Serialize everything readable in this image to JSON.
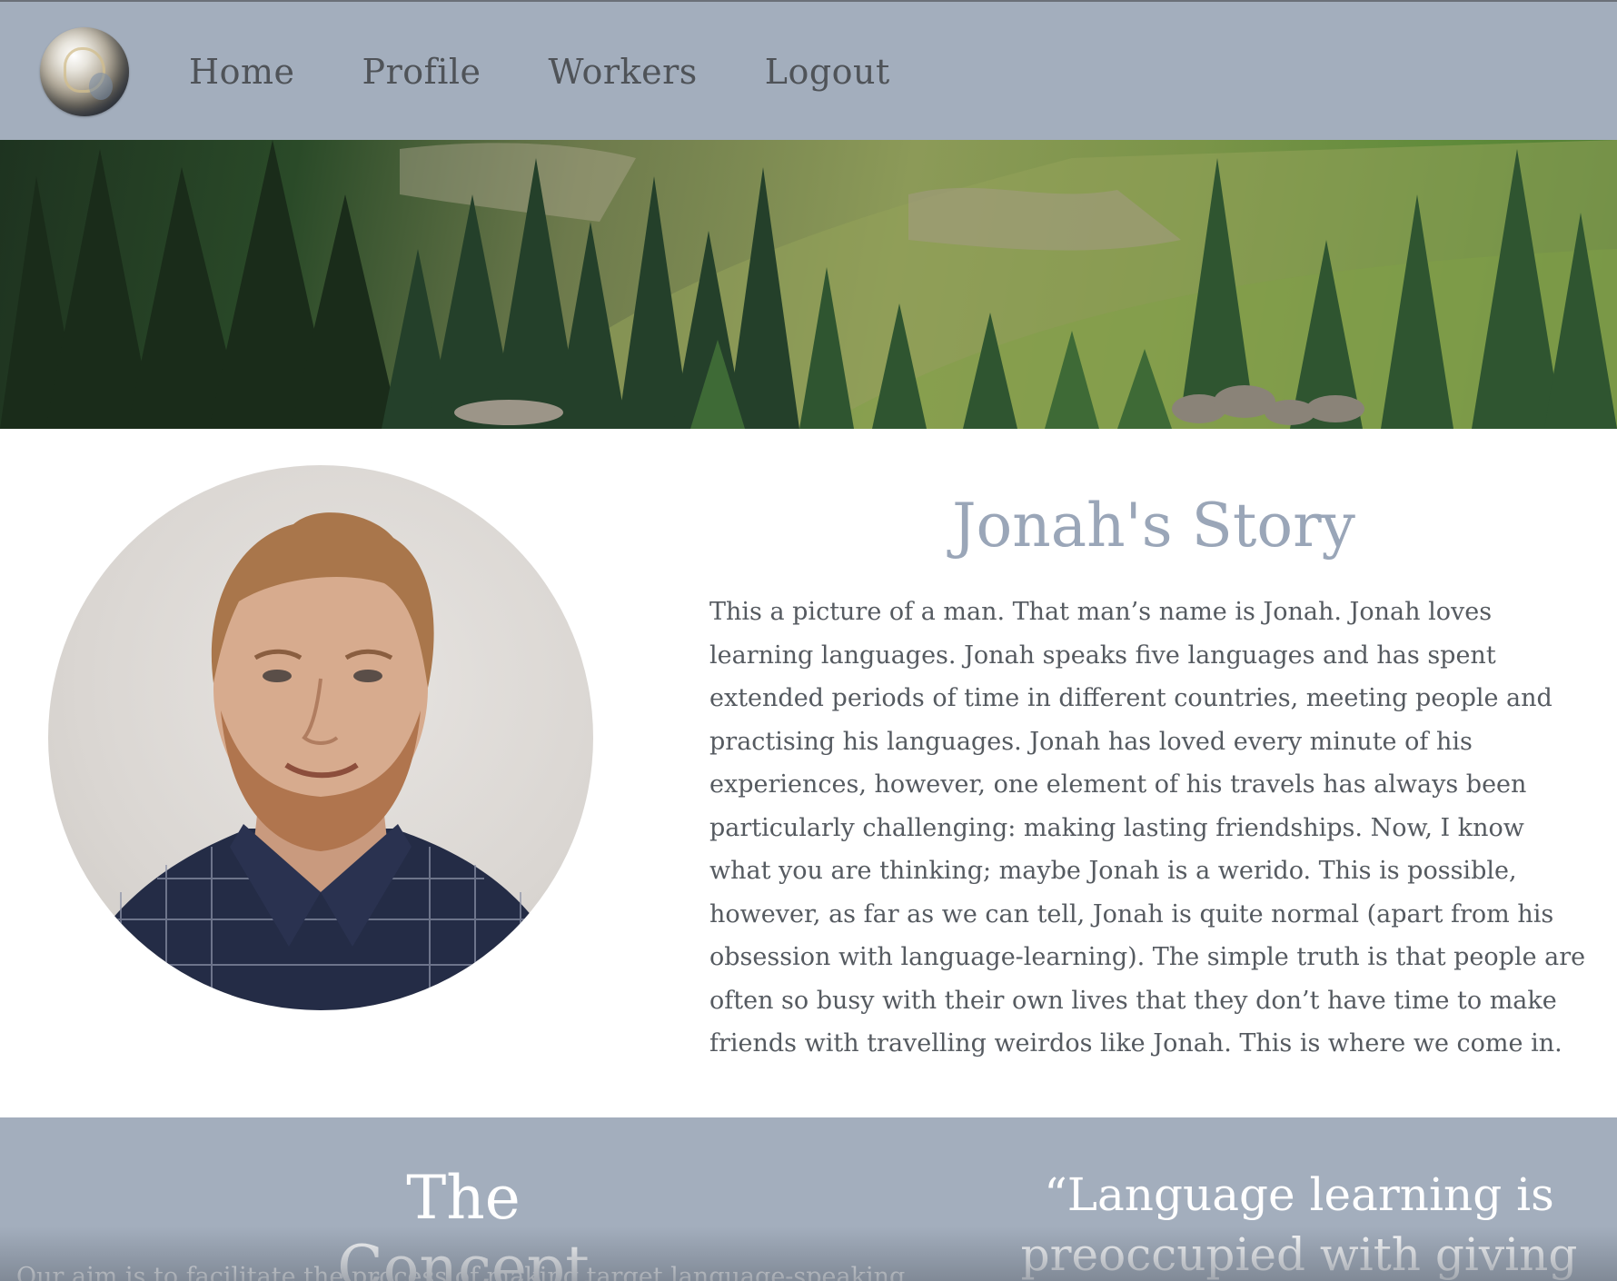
{
  "nav": {
    "items": [
      {
        "label": "Home"
      },
      {
        "label": "Profile"
      },
      {
        "label": "Workers"
      },
      {
        "label": "Logout"
      }
    ]
  },
  "story": {
    "title": "Jonah's Story",
    "body": "This a picture of a man. That man’s name is Jonah. Jonah loves learning languages. Jonah speaks five languages and has spent extended periods of time in different countries, meeting people and practising his languages. Jonah has loved every minute of his experiences, however, one element of his travels has always been particularly challenging: making lasting friendships. Now, I know what you are thinking; maybe Jonah is a werido. This is possible, however, as far as we can tell, Jonah is quite normal (apart from his obsession with language-learning). The simple truth is that people are often so busy with their own lives that they don’t have time to make friends with travelling weirdos like Jonah. This is where we come in."
  },
  "concept": {
    "title": "The Concept",
    "text": "Our aim is to facilitate the process of making target language-speaking",
    "quote": "“Language learning is preoccupied with giving"
  },
  "colors": {
    "nav_bg": "#a3aebd",
    "title_color": "#9aa6b8",
    "text_color": "#555a60"
  }
}
